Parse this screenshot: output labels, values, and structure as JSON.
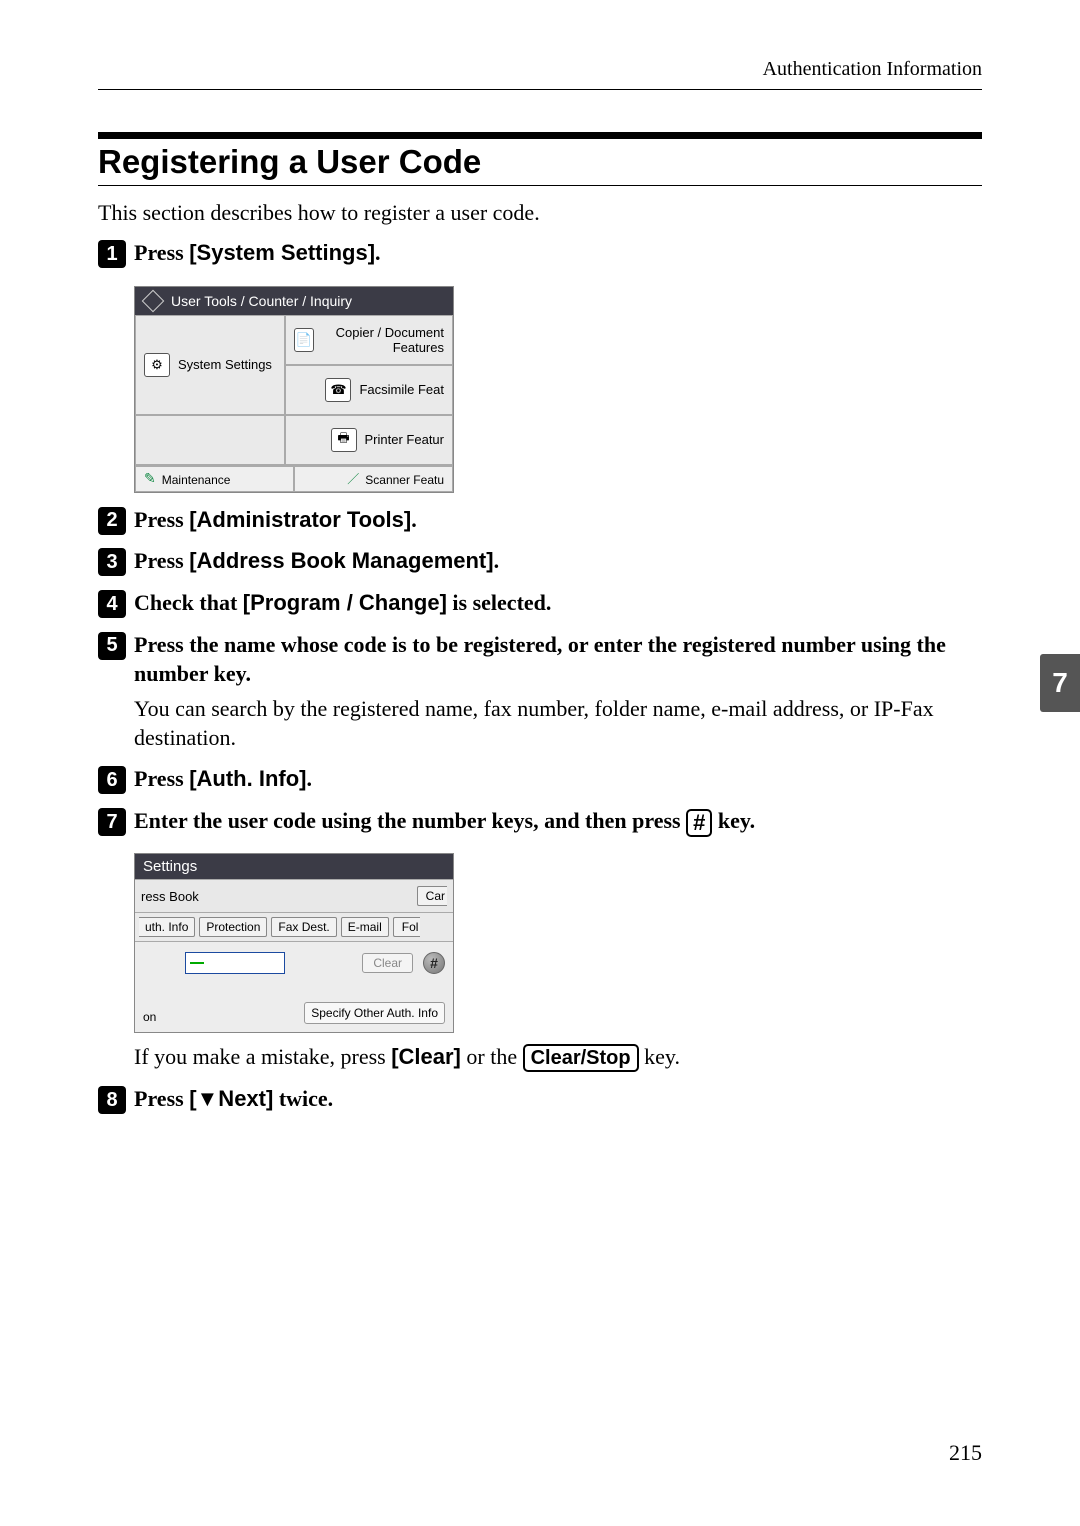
{
  "header": {
    "breadcrumb": "Authentication Information"
  },
  "section": {
    "title": "Registering a User Code"
  },
  "intro": "This section describes how to register a user code.",
  "steps": {
    "s1": {
      "num": "1",
      "prefix": "Press ",
      "bold": "[System Settings]",
      "suffix": "."
    },
    "s2": {
      "num": "2",
      "prefix": "Press ",
      "bold": "[Administrator Tools]",
      "suffix": "."
    },
    "s3": {
      "num": "3",
      "prefix": "Press ",
      "bold": "[Address Book Management]",
      "suffix": "."
    },
    "s4": {
      "num": "4",
      "prefix": "Check that ",
      "bold": "[Program / Change]",
      "suffix": " is selected."
    },
    "s5": {
      "num": "5",
      "text": "Press the name whose code is to be registered, or enter the registered number using the number key.",
      "follow": "You can search by the registered name, fax number, folder name, e-mail address, or IP-Fax destination."
    },
    "s6": {
      "num": "6",
      "prefix": "Press ",
      "bold": "[Auth. Info]",
      "suffix": "."
    },
    "s7": {
      "num": "7",
      "prefix": "Enter the user code using the number keys, and then press ",
      "hash": "#",
      "suffix": " key.",
      "follow_prefix": "If you make a mistake, press ",
      "follow_bold": "[Clear]",
      "follow_mid": " or the ",
      "follow_btn": "Clear/Stop",
      "follow_suffix": " key."
    },
    "s8": {
      "num": "8",
      "prefix": "Press ",
      "bold": "[▼Next]",
      "suffix": " twice."
    }
  },
  "shot1": {
    "title": "User Tools / Counter / Inquiry",
    "system_settings": "System Settings",
    "copier": "Copier / Document Features",
    "fax": "Facsimile Feat",
    "printer": "Printer Featur",
    "maintenance": "Maintenance",
    "scanner": "Scanner Featu"
  },
  "shot2": {
    "title": "Settings",
    "ressbook": "ress Book",
    "car": "Car",
    "tabs": {
      "authinfo": "uth. Info",
      "protection": "Protection",
      "faxdest": "Fax Dest.",
      "email": "E-mail",
      "fol": "Fol"
    },
    "clear": "Clear",
    "hash": "#",
    "on": "on",
    "specify": "Specify Other Auth. Info"
  },
  "side_tab": "7",
  "page_number": "215"
}
